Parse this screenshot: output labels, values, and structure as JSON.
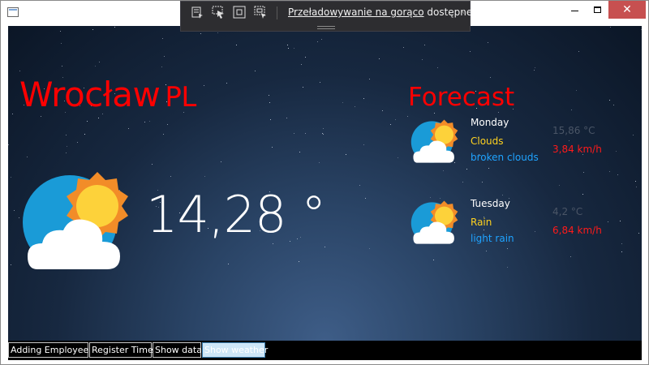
{
  "window": {
    "minimize_glyph": "minimize-icon",
    "maximize_glyph": "maximize-icon",
    "close_label": "✕"
  },
  "debug_toolbar": {
    "link_text": "Przeładowywanie na gorąco",
    "suffix_text": "dostępne",
    "collapse_glyph": "‹",
    "icons": [
      "live-visual-tree-icon",
      "select-element-icon",
      "display-layout-adorners-icon",
      "track-focus-icon"
    ]
  },
  "weather": {
    "city": "Wrocław",
    "country": "PL",
    "temperature": "14,28 °",
    "icon": "partly-cloudy-icon"
  },
  "forecast": {
    "title": "Forecast",
    "days": [
      {
        "day": "Monday",
        "main": "Clouds",
        "description": "broken clouds",
        "temp": "15,86 °C",
        "wind": "3,84 km/h"
      },
      {
        "day": "Tuesday",
        "main": "Rain",
        "description": "light rain",
        "temp": "4,2 °C",
        "wind": "6,84 km/h"
      }
    ]
  },
  "nav": {
    "buttons": [
      {
        "label": "Adding Employee"
      },
      {
        "label": "Register Time"
      },
      {
        "label": "Show data"
      },
      {
        "label": "Show weather",
        "active": true
      }
    ]
  },
  "colors": {
    "accent_red": "#ff0000",
    "forecast_main": "#ffd21f",
    "forecast_desc": "#1fa3ff",
    "close_button": "#c75050"
  }
}
